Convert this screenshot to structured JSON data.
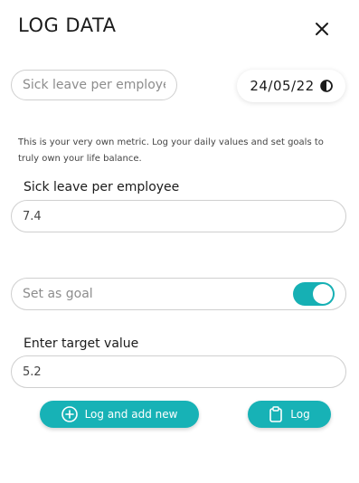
{
  "dialog": {
    "title": "LOG DATA",
    "close_icon": "close-icon"
  },
  "metric_selector": {
    "value": "Sick leave per employee"
  },
  "date_selector": {
    "value": "24/05/22",
    "icon": "half-moon-icon"
  },
  "description": "This is your very own metric. Log your daily values and set goals to truly own your life balance.",
  "metric_field": {
    "label": "Sick leave per employee",
    "value": "7.4"
  },
  "goal": {
    "label": "Set as goal",
    "enabled": true
  },
  "target_field": {
    "label": "Enter target value",
    "value": "5.2"
  },
  "buttons": {
    "log_and_add_label": "Log and add new",
    "log_and_add_icon": "plus-circle-icon",
    "log_label": "Log",
    "log_icon": "clipboard-icon"
  },
  "colors": {
    "accent": "#17b2b6"
  }
}
